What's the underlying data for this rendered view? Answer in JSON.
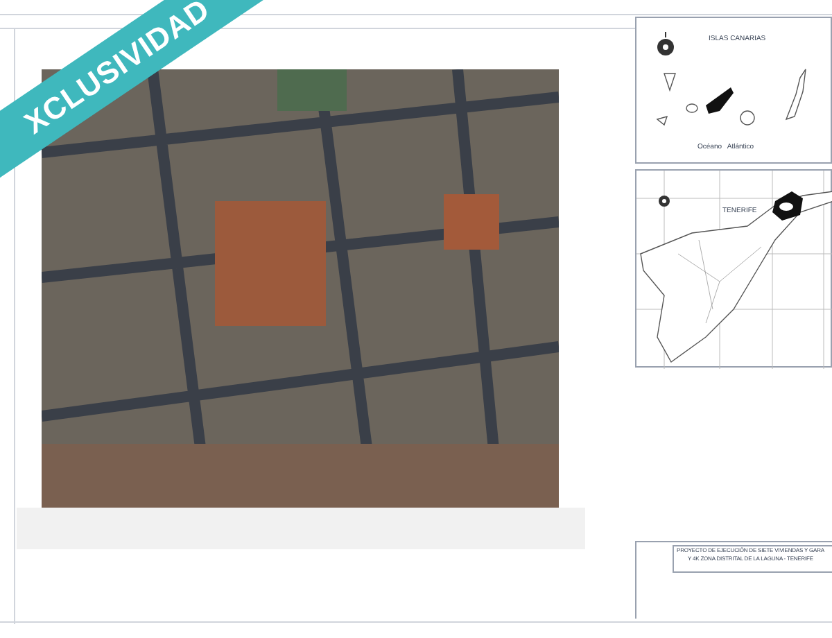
{
  "ribbon": {
    "label": "XCLUSIVIDAD"
  },
  "islands_map": {
    "title": "ISLAS CANARIAS",
    "ocean_label": "Océano   Atlántico"
  },
  "island_map": {
    "title": "TENERIFE"
  },
  "title_block": {
    "lines": [
      "PROYECTO DE EJECUCIÓN DE SIETE VIVIENDAS Y GARA",
      "Y 4K ZONA DISTRITAL DE LA LAGUNA - TENERIFE"
    ]
  }
}
